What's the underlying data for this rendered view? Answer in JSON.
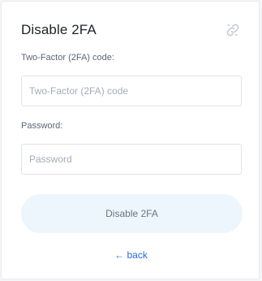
{
  "card": {
    "title": "Disable 2FA",
    "header_icon": "unlink-icon"
  },
  "form": {
    "code_label": "Two-Factor (2FA) code:",
    "code_placeholder": "Two-Factor (2FA) code",
    "code_value": "",
    "password_label": "Password:",
    "password_placeholder": "Password",
    "password_value": "",
    "submit_label": "Disable 2FA",
    "back_label": "← back"
  },
  "colors": {
    "accent": "#2a6ad9",
    "button_bg": "#edf5fd",
    "button_text": "#6a7482",
    "title": "#1e2329",
    "label": "#5b6675",
    "border": "#dfe3e8"
  }
}
